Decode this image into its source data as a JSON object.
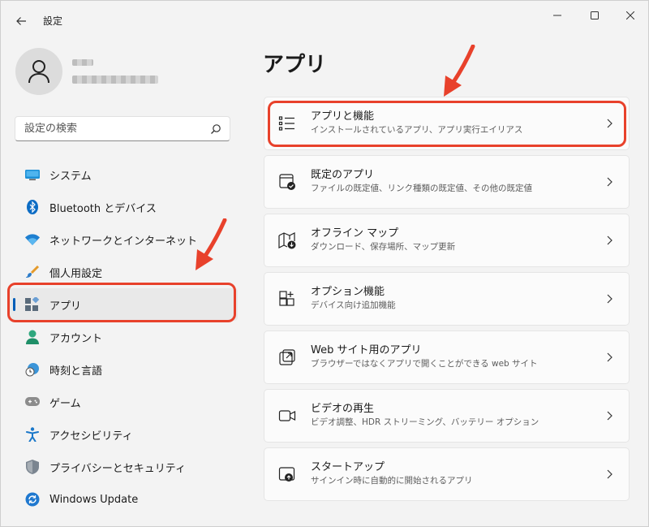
{
  "window": {
    "title": "設定"
  },
  "search": {
    "placeholder": "設定の検索"
  },
  "sidebar": {
    "items": [
      {
        "label": "システム",
        "icon": "monitor-icon"
      },
      {
        "label": "Bluetooth とデバイス",
        "icon": "bluetooth-icon"
      },
      {
        "label": "ネットワークとインターネット",
        "icon": "wifi-icon"
      },
      {
        "label": "個人用設定",
        "icon": "brush-icon"
      },
      {
        "label": "アプリ",
        "icon": "apps-icon",
        "active": true
      },
      {
        "label": "アカウント",
        "icon": "person-icon"
      },
      {
        "label": "時刻と言語",
        "icon": "clock-globe-icon"
      },
      {
        "label": "ゲーム",
        "icon": "gamepad-icon"
      },
      {
        "label": "アクセシビリティ",
        "icon": "accessibility-icon"
      },
      {
        "label": "プライバシーとセキュリティ",
        "icon": "shield-icon"
      },
      {
        "label": "Windows Update",
        "icon": "update-icon"
      }
    ]
  },
  "main": {
    "title": "アプリ",
    "cards": [
      {
        "title": "アプリと機能",
        "subtitle": "インストールされているアプリ、アプリ実行エイリアス",
        "icon": "list-icon"
      },
      {
        "title": "既定のアプリ",
        "subtitle": "ファイルの既定値、リンク種類の既定値、その他の既定値",
        "icon": "default-apps-icon"
      },
      {
        "title": "オフライン マップ",
        "subtitle": "ダウンロード、保存場所、マップ更新",
        "icon": "offline-map-icon"
      },
      {
        "title": "オプション機能",
        "subtitle": "デバイス向け追加機能",
        "icon": "optional-features-icon"
      },
      {
        "title": "Web サイト用のアプリ",
        "subtitle": "ブラウザーではなくアプリで開くことができる web サイト",
        "icon": "web-app-icon"
      },
      {
        "title": "ビデオの再生",
        "subtitle": "ビデオ調整、HDR ストリーミング、バッテリー オプション",
        "icon": "video-icon"
      },
      {
        "title": "スタートアップ",
        "subtitle": "サインイン時に自動的に開始されるアプリ",
        "icon": "startup-icon"
      }
    ]
  },
  "colors": {
    "accent": "#005fb8",
    "annotation": "#e8412b"
  }
}
